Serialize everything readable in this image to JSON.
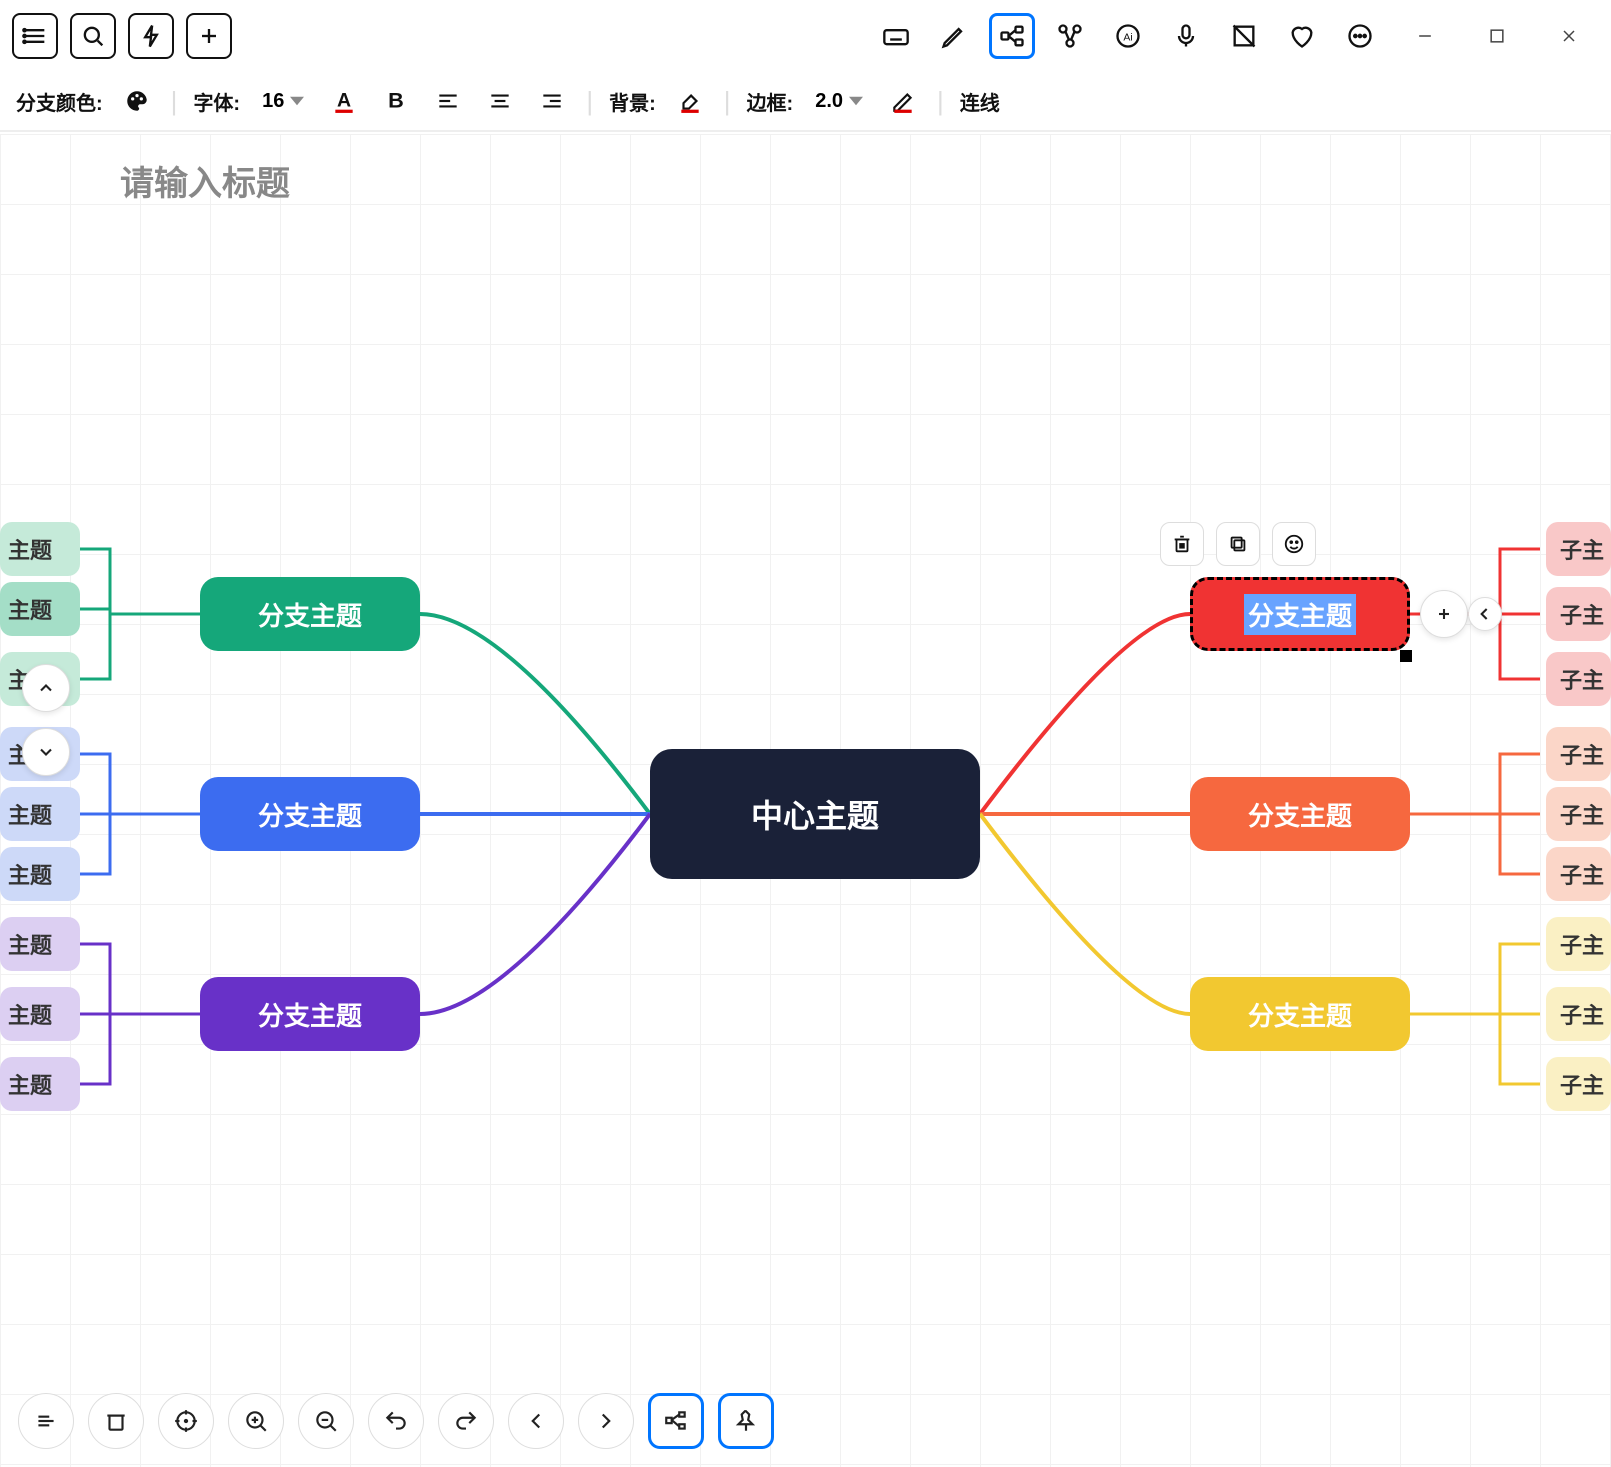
{
  "toolbar_fmt": {
    "branch_color_label": "分支颜色:",
    "font_label": "字体:",
    "font_size": "16",
    "bg_label": "背景:",
    "border_label": "边框:",
    "border_width": "2.0",
    "connector_label": "连线"
  },
  "canvas": {
    "title_placeholder": "请输入标题",
    "center": "中心主题",
    "branch_label": "分支主题",
    "sub_label_left": "主题",
    "sub_label_right": "子主"
  },
  "colors": {
    "green": "#15a77a",
    "blue": "#3c6cf0",
    "purple": "#6831c8",
    "red": "#f03333",
    "orange": "#f6683f",
    "yellow": "#f2c830"
  }
}
